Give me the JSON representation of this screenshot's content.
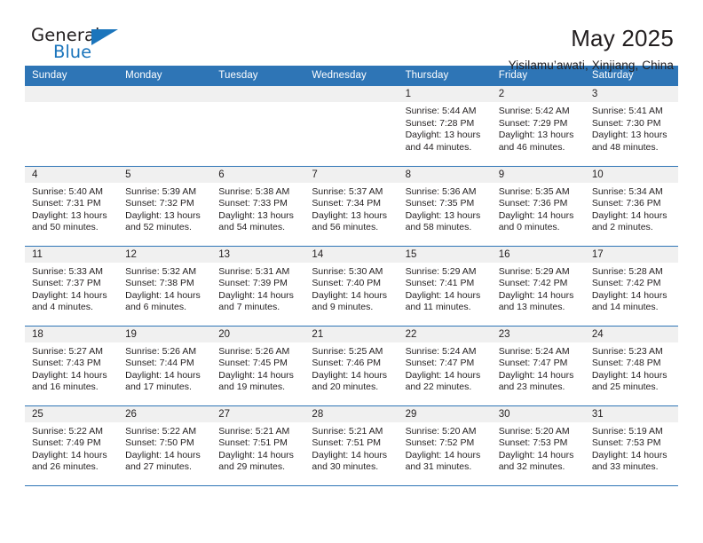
{
  "brand": {
    "word_general": "General",
    "word_blue": "Blue",
    "accent_color": "#1b75bc",
    "header_color": "#2e75b6"
  },
  "header": {
    "title": "May 2025",
    "subtitle": "Yisilamu’awati, Xinjiang, China"
  },
  "calendar": {
    "weekdays": [
      "Sunday",
      "Monday",
      "Tuesday",
      "Wednesday",
      "Thursday",
      "Friday",
      "Saturday"
    ],
    "weeks": [
      [
        {
          "day": "",
          "lines": []
        },
        {
          "day": "",
          "lines": []
        },
        {
          "day": "",
          "lines": []
        },
        {
          "day": "",
          "lines": []
        },
        {
          "day": "1",
          "lines": [
            "Sunrise: 5:44 AM",
            "Sunset: 7:28 PM",
            "Daylight: 13 hours",
            "and 44 minutes."
          ]
        },
        {
          "day": "2",
          "lines": [
            "Sunrise: 5:42 AM",
            "Sunset: 7:29 PM",
            "Daylight: 13 hours",
            "and 46 minutes."
          ]
        },
        {
          "day": "3",
          "lines": [
            "Sunrise: 5:41 AM",
            "Sunset: 7:30 PM",
            "Daylight: 13 hours",
            "and 48 minutes."
          ]
        }
      ],
      [
        {
          "day": "4",
          "lines": [
            "Sunrise: 5:40 AM",
            "Sunset: 7:31 PM",
            "Daylight: 13 hours",
            "and 50 minutes."
          ]
        },
        {
          "day": "5",
          "lines": [
            "Sunrise: 5:39 AM",
            "Sunset: 7:32 PM",
            "Daylight: 13 hours",
            "and 52 minutes."
          ]
        },
        {
          "day": "6",
          "lines": [
            "Sunrise: 5:38 AM",
            "Sunset: 7:33 PM",
            "Daylight: 13 hours",
            "and 54 minutes."
          ]
        },
        {
          "day": "7",
          "lines": [
            "Sunrise: 5:37 AM",
            "Sunset: 7:34 PM",
            "Daylight: 13 hours",
            "and 56 minutes."
          ]
        },
        {
          "day": "8",
          "lines": [
            "Sunrise: 5:36 AM",
            "Sunset: 7:35 PM",
            "Daylight: 13 hours",
            "and 58 minutes."
          ]
        },
        {
          "day": "9",
          "lines": [
            "Sunrise: 5:35 AM",
            "Sunset: 7:36 PM",
            "Daylight: 14 hours",
            "and 0 minutes."
          ]
        },
        {
          "day": "10",
          "lines": [
            "Sunrise: 5:34 AM",
            "Sunset: 7:36 PM",
            "Daylight: 14 hours",
            "and 2 minutes."
          ]
        }
      ],
      [
        {
          "day": "11",
          "lines": [
            "Sunrise: 5:33 AM",
            "Sunset: 7:37 PM",
            "Daylight: 14 hours",
            "and 4 minutes."
          ]
        },
        {
          "day": "12",
          "lines": [
            "Sunrise: 5:32 AM",
            "Sunset: 7:38 PM",
            "Daylight: 14 hours",
            "and 6 minutes."
          ]
        },
        {
          "day": "13",
          "lines": [
            "Sunrise: 5:31 AM",
            "Sunset: 7:39 PM",
            "Daylight: 14 hours",
            "and 7 minutes."
          ]
        },
        {
          "day": "14",
          "lines": [
            "Sunrise: 5:30 AM",
            "Sunset: 7:40 PM",
            "Daylight: 14 hours",
            "and 9 minutes."
          ]
        },
        {
          "day": "15",
          "lines": [
            "Sunrise: 5:29 AM",
            "Sunset: 7:41 PM",
            "Daylight: 14 hours",
            "and 11 minutes."
          ]
        },
        {
          "day": "16",
          "lines": [
            "Sunrise: 5:29 AM",
            "Sunset: 7:42 PM",
            "Daylight: 14 hours",
            "and 13 minutes."
          ]
        },
        {
          "day": "17",
          "lines": [
            "Sunrise: 5:28 AM",
            "Sunset: 7:42 PM",
            "Daylight: 14 hours",
            "and 14 minutes."
          ]
        }
      ],
      [
        {
          "day": "18",
          "lines": [
            "Sunrise: 5:27 AM",
            "Sunset: 7:43 PM",
            "Daylight: 14 hours",
            "and 16 minutes."
          ]
        },
        {
          "day": "19",
          "lines": [
            "Sunrise: 5:26 AM",
            "Sunset: 7:44 PM",
            "Daylight: 14 hours",
            "and 17 minutes."
          ]
        },
        {
          "day": "20",
          "lines": [
            "Sunrise: 5:26 AM",
            "Sunset: 7:45 PM",
            "Daylight: 14 hours",
            "and 19 minutes."
          ]
        },
        {
          "day": "21",
          "lines": [
            "Sunrise: 5:25 AM",
            "Sunset: 7:46 PM",
            "Daylight: 14 hours",
            "and 20 minutes."
          ]
        },
        {
          "day": "22",
          "lines": [
            "Sunrise: 5:24 AM",
            "Sunset: 7:47 PM",
            "Daylight: 14 hours",
            "and 22 minutes."
          ]
        },
        {
          "day": "23",
          "lines": [
            "Sunrise: 5:24 AM",
            "Sunset: 7:47 PM",
            "Daylight: 14 hours",
            "and 23 minutes."
          ]
        },
        {
          "day": "24",
          "lines": [
            "Sunrise: 5:23 AM",
            "Sunset: 7:48 PM",
            "Daylight: 14 hours",
            "and 25 minutes."
          ]
        }
      ],
      [
        {
          "day": "25",
          "lines": [
            "Sunrise: 5:22 AM",
            "Sunset: 7:49 PM",
            "Daylight: 14 hours",
            "and 26 minutes."
          ]
        },
        {
          "day": "26",
          "lines": [
            "Sunrise: 5:22 AM",
            "Sunset: 7:50 PM",
            "Daylight: 14 hours",
            "and 27 minutes."
          ]
        },
        {
          "day": "27",
          "lines": [
            "Sunrise: 5:21 AM",
            "Sunset: 7:51 PM",
            "Daylight: 14 hours",
            "and 29 minutes."
          ]
        },
        {
          "day": "28",
          "lines": [
            "Sunrise: 5:21 AM",
            "Sunset: 7:51 PM",
            "Daylight: 14 hours",
            "and 30 minutes."
          ]
        },
        {
          "day": "29",
          "lines": [
            "Sunrise: 5:20 AM",
            "Sunset: 7:52 PM",
            "Daylight: 14 hours",
            "and 31 minutes."
          ]
        },
        {
          "day": "30",
          "lines": [
            "Sunrise: 5:20 AM",
            "Sunset: 7:53 PM",
            "Daylight: 14 hours",
            "and 32 minutes."
          ]
        },
        {
          "day": "31",
          "lines": [
            "Sunrise: 5:19 AM",
            "Sunset: 7:53 PM",
            "Daylight: 14 hours",
            "and 33 minutes."
          ]
        }
      ]
    ]
  }
}
